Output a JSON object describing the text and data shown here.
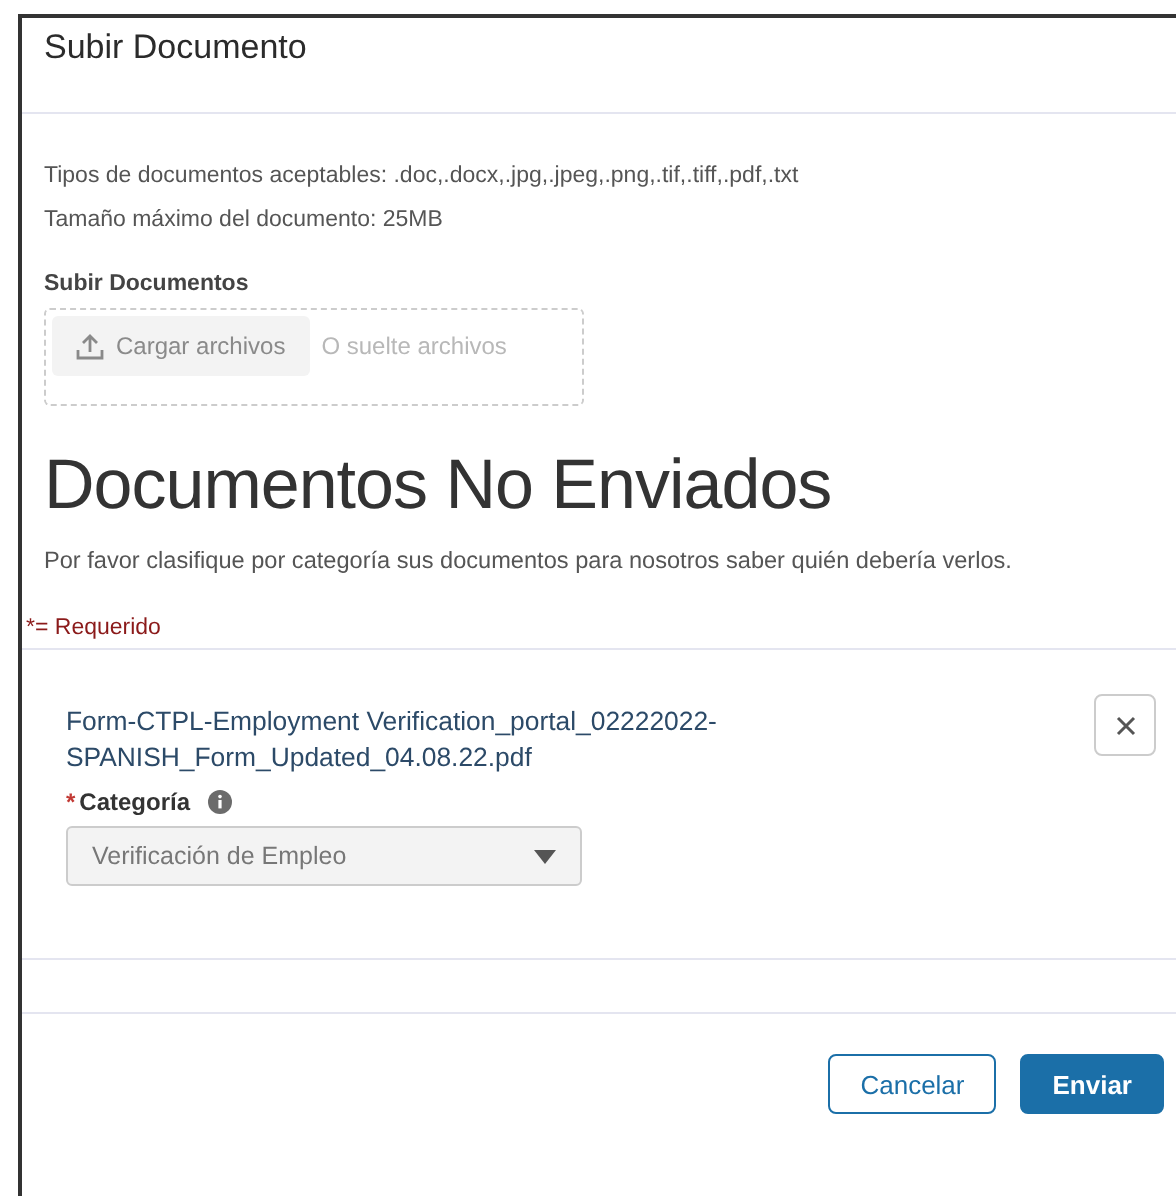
{
  "dialog": {
    "title": "Subir Documento"
  },
  "info": [
    "Tipos de documentos aceptables: .doc,.docx,.jpg,.jpeg,.png,.tif,.tiff,.pdf,.txt",
    "Tamaño máximo del documento: 25MB"
  ],
  "upload": {
    "label": "Subir Documentos",
    "button": "Cargar archivos",
    "disabled": true,
    "drop_hint": "O suelte archivos"
  },
  "section": {
    "heading": "Documentos No Enviados",
    "description": "Por favor clasifique por categoría sus documentos para nosotros saber quién debería verlos.",
    "required_note": "*= Requerido"
  },
  "documents": [
    {
      "file_name": "Form-CTPL-Employment Verification_portal_02222022-SPANISH_Form_Updated_04.08.22.pdf",
      "category_label": "Categoría",
      "required": true,
      "required_mark": "*",
      "category_value": "Verificación de Empleo",
      "disabled": true
    }
  ],
  "buttons": [
    {
      "label": "Cancelar",
      "kind": "secondary"
    },
    {
      "label": "Enviar",
      "kind": "primary"
    }
  ]
}
